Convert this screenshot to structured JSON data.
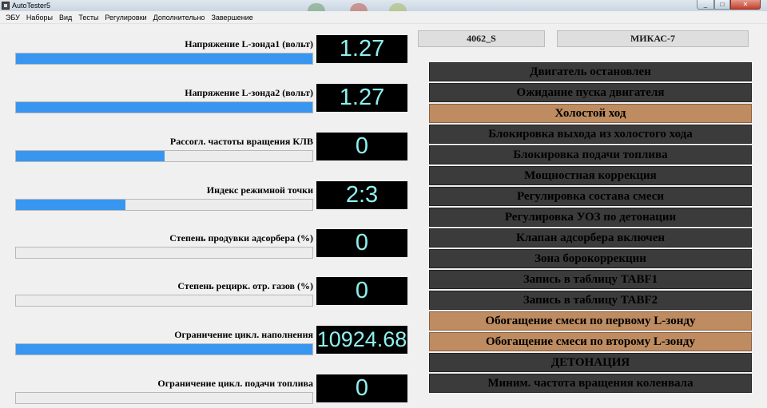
{
  "window": {
    "title": "AutoTester5",
    "buttons": {
      "minimize": "_",
      "maximize": "□",
      "close": "✕"
    }
  },
  "menu": [
    "ЭБУ",
    "Наборы",
    "Вид",
    "Тесты",
    "Регулировки",
    "Дополнительно",
    "Завершение"
  ],
  "params": [
    {
      "label": "Напряжение L-зонда1 (вольт)",
      "value": "1.27",
      "level": 1.0
    },
    {
      "label": "Напряжение L-зонда2 (вольт)",
      "value": "1.27",
      "level": 1.0
    },
    {
      "label": "Рассогл. частоты вращения КЛВ",
      "value": "0",
      "level": 0.5
    },
    {
      "label": "Индекс режимной точки",
      "value": "2:3",
      "level": 0.37
    },
    {
      "label": "Степень продувки адсорбера (%)",
      "value": "0",
      "level": 0.0
    },
    {
      "label": "Степень рецирк. отр. газов (%)",
      "value": "0",
      "level": 0.0
    },
    {
      "label": "Ограничение цикл. наполнения",
      "value": "10924.68",
      "level": 1.0
    },
    {
      "label": "Ограничение цикл. подачи топлива",
      "value": "0",
      "level": 0.0
    }
  ],
  "info": {
    "ecu_id": "4062_S",
    "ecu_type": "МИКАС-7"
  },
  "statuses": [
    {
      "label": "Двигатель остановлен",
      "active": false
    },
    {
      "label": "Ожидание пуска двигателя",
      "active": false
    },
    {
      "label": "Холостой ход",
      "active": true
    },
    {
      "label": "Блокировка выхода из холостого хода",
      "active": false
    },
    {
      "label": "Блокировка подачи топлива",
      "active": false
    },
    {
      "label": "Мощностная коррекция",
      "active": false
    },
    {
      "label": "Регулировка состава смеси",
      "active": false
    },
    {
      "label": "Регулировка УОЗ по детонации",
      "active": false
    },
    {
      "label": "Клапан адсорбера включен",
      "active": false
    },
    {
      "label": "Зона борокоррекции",
      "active": false
    },
    {
      "label": "Запись в таблицу TABF1",
      "active": false
    },
    {
      "label": "Запись в таблицу TABF2",
      "active": false
    },
    {
      "label": "Обогащение смеси по первому L-зонду",
      "active": true
    },
    {
      "label": "Обогащение смеси по второму  L-зонду",
      "active": true
    },
    {
      "label": "ДЕТОНАЦИЯ",
      "active": false
    },
    {
      "label": "Миним. частота вращения коленвала",
      "active": false
    }
  ],
  "colors": {
    "bar_fill": "#3896f0",
    "display_bg": "#000000",
    "display_text": "#8ef0ee",
    "status_inactive": "#3b3b3b",
    "status_active": "#be8c60"
  }
}
